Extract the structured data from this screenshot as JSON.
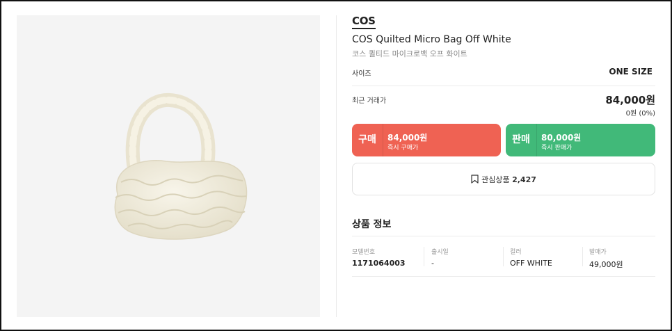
{
  "product": {
    "brand": "COS",
    "title_en": "COS Quilted Micro Bag Off White",
    "title_ko": "코스 퀼티드 마이크로백 오프 화이트",
    "image_alt": "quilted micro bag off white"
  },
  "size": {
    "label": "사이즈",
    "value": "ONE SIZE"
  },
  "recent": {
    "label": "최근 거래가",
    "price": "84,000원",
    "change": "0원 (0%)"
  },
  "buy": {
    "kind": "구매",
    "price": "84,000원",
    "sub": "즉시 구매가"
  },
  "sell": {
    "kind": "판매",
    "price": "80,000원",
    "sub": "즉시 판매가"
  },
  "wish": {
    "label": "관심상품",
    "count": "2,427"
  },
  "section": {
    "title": "상품 정보"
  },
  "specs": [
    {
      "label": "모델번호",
      "value": "1171064003"
    },
    {
      "label": "출시일",
      "value": "-"
    },
    {
      "label": "컬러",
      "value": "OFF WHITE"
    },
    {
      "label": "발매가",
      "value": "49,000원"
    }
  ],
  "colors": {
    "buy": "#ef6253",
    "sell": "#41b979",
    "image_bg": "#f4f4f4",
    "bag": "#f1ecdc"
  }
}
